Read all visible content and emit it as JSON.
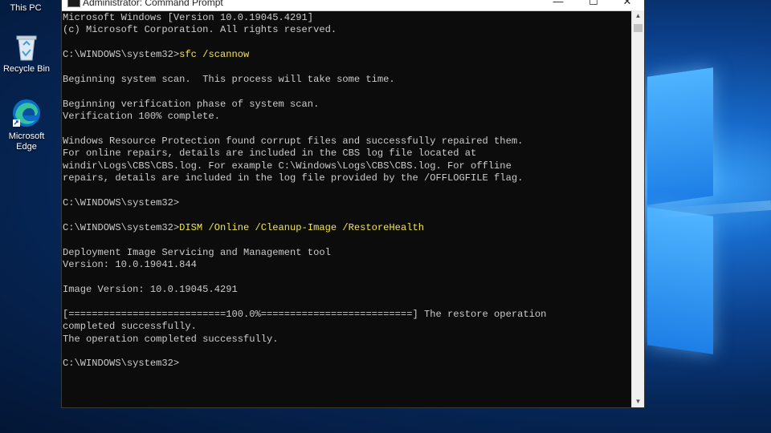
{
  "desktop": {
    "icons": [
      {
        "name": "this-pc",
        "label": "This PC"
      },
      {
        "name": "recycle-bin",
        "label": "Recycle Bin"
      },
      {
        "name": "microsoft-edge",
        "label": "Microsoft Edge"
      }
    ]
  },
  "window": {
    "title": "Administrator: Command Prompt",
    "minimize": "—",
    "maximize": "☐",
    "close": "✕"
  },
  "console": {
    "lines": [
      {
        "text": "Microsoft Windows [Version 10.0.19045.4291]"
      },
      {
        "text": "(c) Microsoft Corporation. All rights reserved."
      },
      {
        "text": ""
      },
      {
        "prompt": "C:\\WINDOWS\\system32>",
        "command": "sfc /scannow"
      },
      {
        "text": ""
      },
      {
        "text": "Beginning system scan.  This process will take some time."
      },
      {
        "text": ""
      },
      {
        "text": "Beginning verification phase of system scan."
      },
      {
        "text": "Verification 100% complete."
      },
      {
        "text": ""
      },
      {
        "text": "Windows Resource Protection found corrupt files and successfully repaired them."
      },
      {
        "text": "For online repairs, details are included in the CBS log file located at"
      },
      {
        "text": "windir\\Logs\\CBS\\CBS.log. For example C:\\Windows\\Logs\\CBS\\CBS.log. For offline"
      },
      {
        "text": "repairs, details are included in the log file provided by the /OFFLOGFILE flag."
      },
      {
        "text": ""
      },
      {
        "text": "C:\\WINDOWS\\system32>"
      },
      {
        "text": ""
      },
      {
        "prompt": "C:\\WINDOWS\\system32>",
        "command": "DISM /Online /Cleanup-Image /RestoreHealth"
      },
      {
        "text": ""
      },
      {
        "text": "Deployment Image Servicing and Management tool"
      },
      {
        "text": "Version: 10.0.19041.844"
      },
      {
        "text": ""
      },
      {
        "text": "Image Version: 10.0.19045.4291"
      },
      {
        "text": ""
      },
      {
        "text": "[===========================100.0%==========================] The restore operation"
      },
      {
        "text": "completed successfully."
      },
      {
        "text": "The operation completed successfully."
      },
      {
        "text": ""
      },
      {
        "text": "C:\\WINDOWS\\system32>"
      }
    ]
  },
  "colors": {
    "console_bg": "#0c0c0c",
    "console_text": "#cccccc",
    "command_text": "#f2e64a",
    "desktop_accent": "#1d7fe6"
  }
}
